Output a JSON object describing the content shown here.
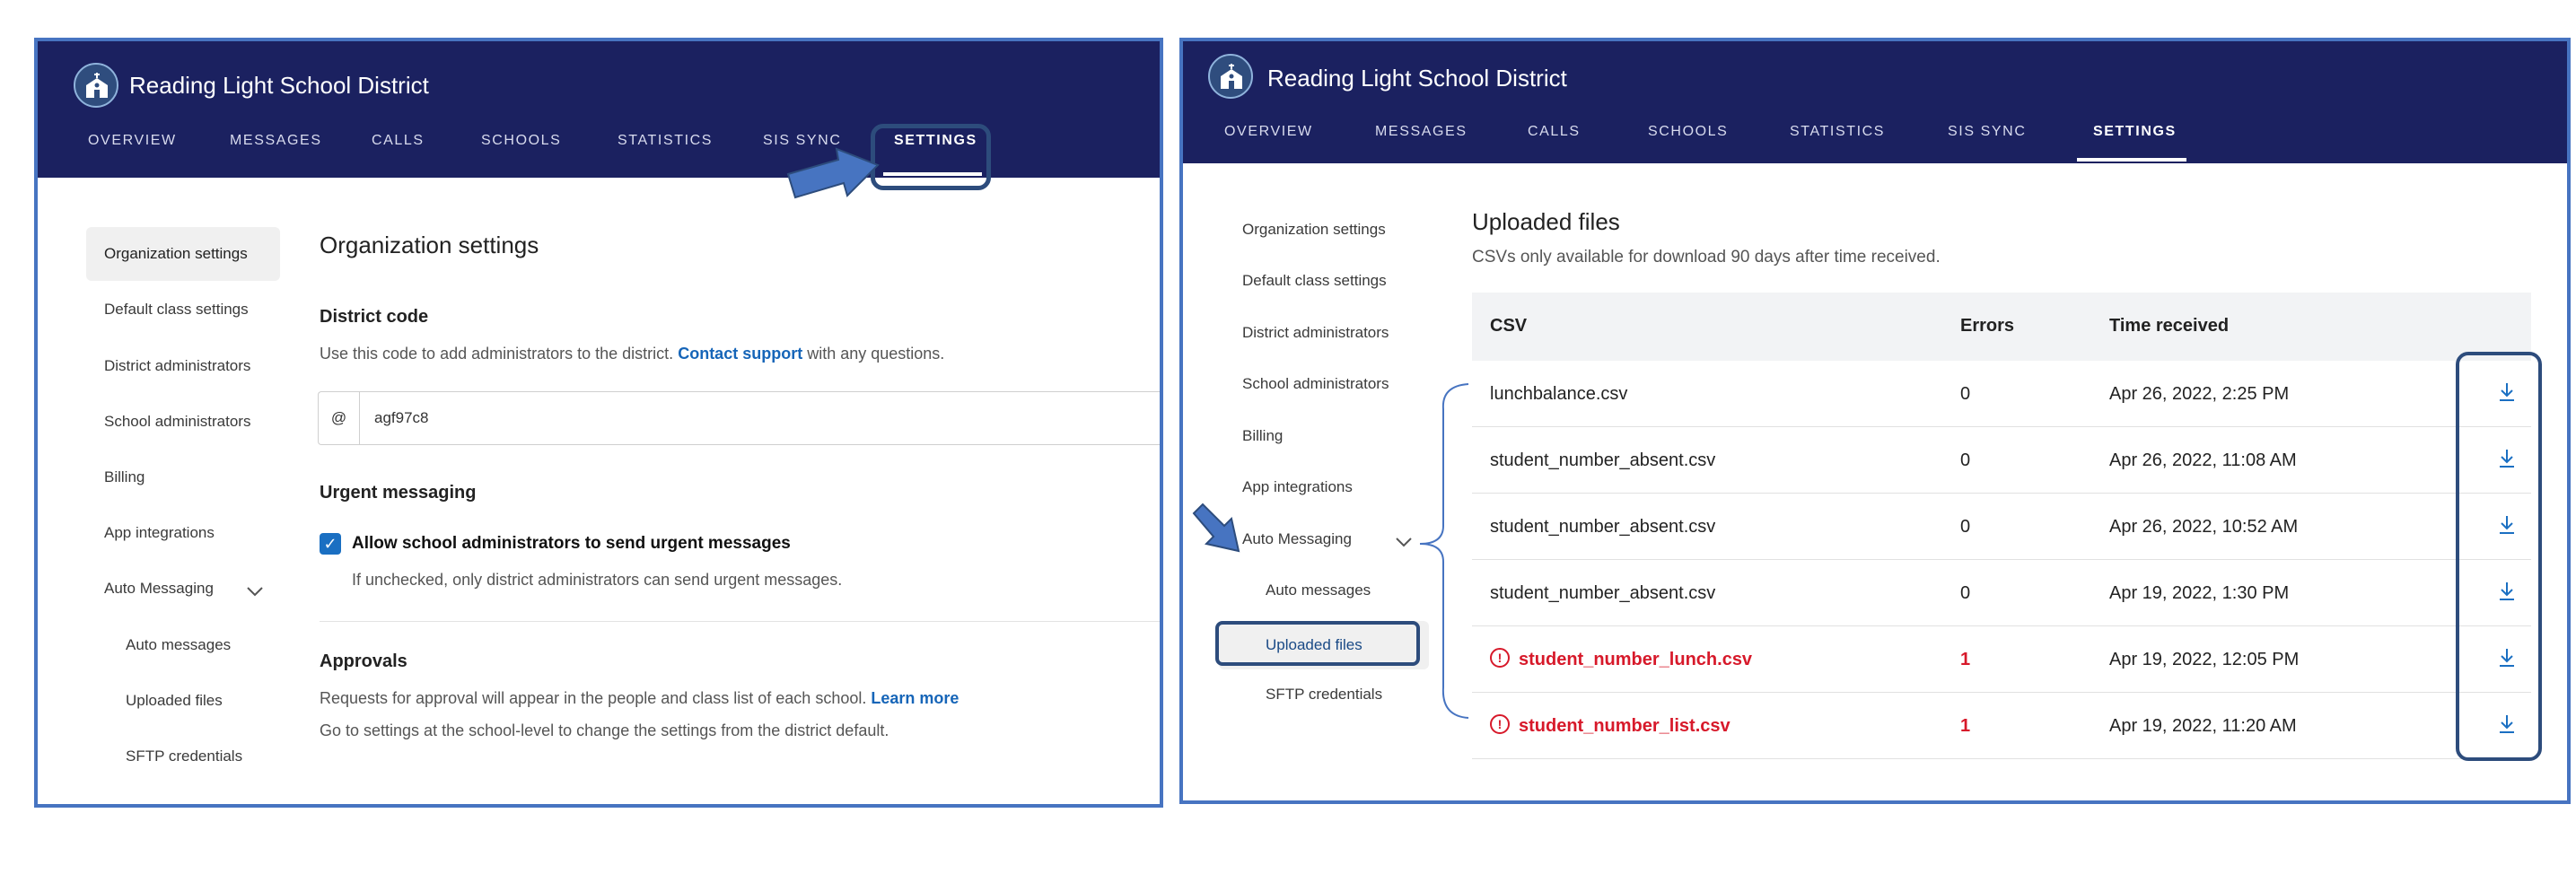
{
  "org_name": "Reading Light School District",
  "nav_tabs": [
    "OVERVIEW",
    "MESSAGES",
    "CALLS",
    "SCHOOLS",
    "STATISTICS",
    "SIS SYNC",
    "SETTINGS"
  ],
  "sidebar": {
    "items": [
      "Organization settings",
      "Default class settings",
      "District administrators",
      "School administrators",
      "Billing",
      "App integrations",
      "Auto Messaging"
    ],
    "sub_items": [
      "Auto messages",
      "Uploaded files",
      "SFTP credentials"
    ]
  },
  "left_panel": {
    "page_title": "Organization settings",
    "district_code": {
      "heading": "District code",
      "description_pre": "Use this code to add administrators to the district.",
      "link": "Contact support",
      "description_post": "with any questions.",
      "prefix": "@",
      "value": "agf97c8"
    },
    "urgent": {
      "heading": "Urgent messaging",
      "checkbox_label": "Allow school administrators to send urgent messages",
      "checked": true,
      "help": "If unchecked, only district administrators can send urgent messages."
    },
    "approvals": {
      "heading": "Approvals",
      "line1_pre": "Requests for approval will appear in the people and class list of each school.",
      "line1_link": "Learn more",
      "line2": "Go to settings at the school-level to change the settings from the district default."
    }
  },
  "right_panel": {
    "page_title": "Uploaded files",
    "subtitle": "CSVs only available for download 90 days after time received.",
    "table": {
      "headers": [
        "CSV",
        "Errors",
        "Time received"
      ],
      "rows": [
        {
          "file": "lunchbalance.csv",
          "errors": "0",
          "time": "Apr 26, 2022, 2:25 PM",
          "error": false
        },
        {
          "file": "student_number_absent.csv",
          "errors": "0",
          "time": "Apr 26, 2022, 11:08 AM",
          "error": false
        },
        {
          "file": "student_number_absent.csv",
          "errors": "0",
          "time": "Apr 26, 2022, 10:52 AM",
          "error": false
        },
        {
          "file": "student_number_absent.csv",
          "errors": "0",
          "time": "Apr 19, 2022, 1:30 PM",
          "error": false
        },
        {
          "file": "student_number_lunch.csv",
          "errors": "1",
          "time": "Apr 19, 2022, 12:05 PM",
          "error": true
        },
        {
          "file": "student_number_list.csv",
          "errors": "1",
          "time": "Apr 19, 2022, 11:20 AM",
          "error": true
        }
      ]
    }
  },
  "colors": {
    "header_bg": "#1b2160",
    "accent": "#1a6fc2",
    "error": "#d7192a",
    "annotation": "#4774c1"
  }
}
